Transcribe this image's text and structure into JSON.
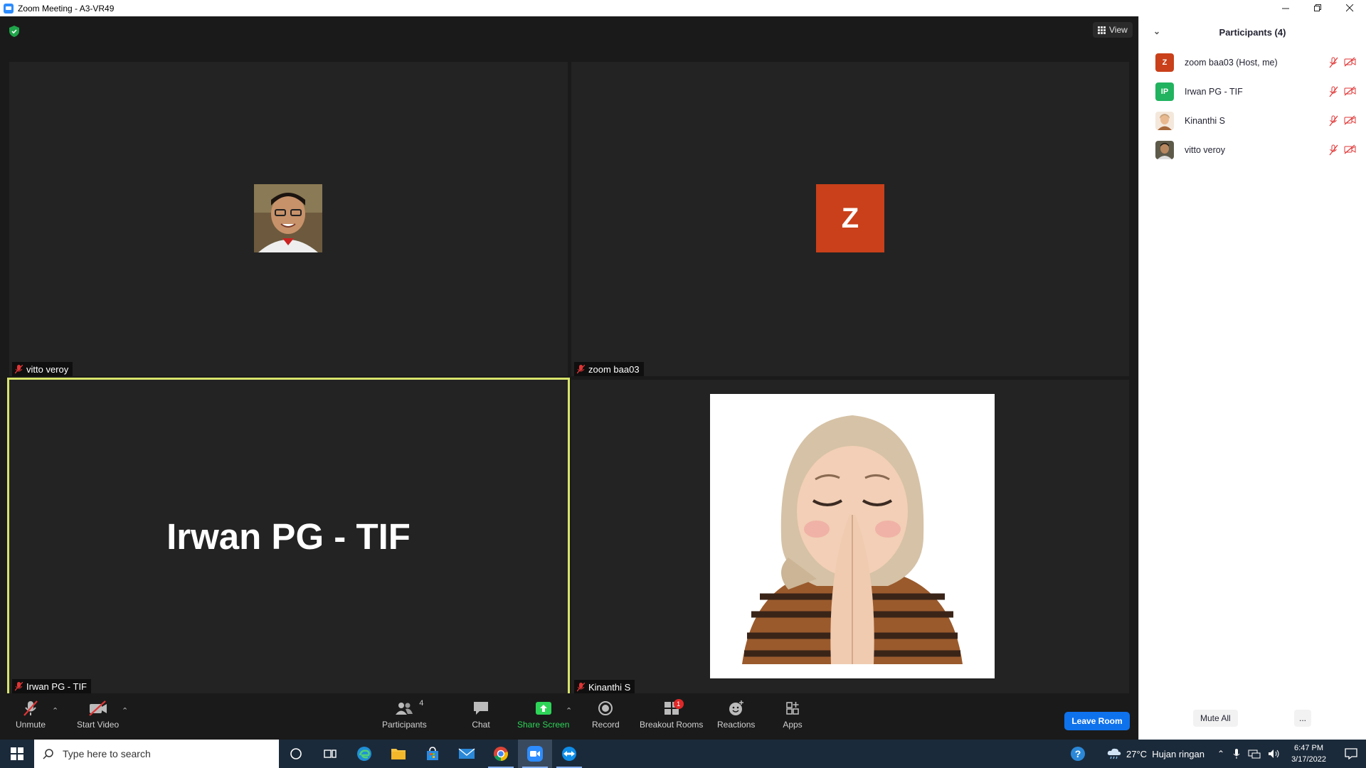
{
  "window": {
    "title": "Zoom Meeting - A3-VR49",
    "controls": [
      "minimize",
      "restore",
      "close"
    ]
  },
  "meeting": {
    "view_label": "View",
    "tiles": [
      {
        "name": "vitto veroy",
        "kind": "photo",
        "muted": true
      },
      {
        "name": "zoom baa03",
        "kind": "initial",
        "initial": "Z",
        "avatar_color": "#c9401a",
        "muted": true
      },
      {
        "name": "Irwan PG - TIF",
        "kind": "name-only",
        "display_name": "Irwan PG - TIF",
        "muted": true,
        "active_speaker": true
      },
      {
        "name": "Kinanthi S",
        "kind": "memoji",
        "muted": true
      }
    ]
  },
  "toolbar": {
    "unmute": "Unmute",
    "start_video": "Start Video",
    "participants": "Participants",
    "participants_count": "4",
    "chat": "Chat",
    "share_screen": "Share Screen",
    "record": "Record",
    "breakout_rooms": "Breakout Rooms",
    "breakout_badge": "1",
    "reactions": "Reactions",
    "apps": "Apps",
    "leave": "Leave Room",
    "share_color": "#2ed458",
    "leave_color": "#0e72ed"
  },
  "participants_panel": {
    "title": "Participants (4)",
    "items": [
      {
        "name": "zoom baa03 (Host, me)",
        "avatar": "Z",
        "avatar_color": "#c9401a",
        "mic": "muted",
        "video": "off"
      },
      {
        "name": "Irwan PG - TIF",
        "avatar": "IP",
        "avatar_color": "#21b35f",
        "mic": "muted",
        "video": "off"
      },
      {
        "name": "Kinanthi S",
        "avatar": "photo",
        "mic": "muted",
        "video": "off"
      },
      {
        "name": "vitto veroy",
        "avatar": "photo",
        "mic": "muted",
        "video": "off"
      }
    ],
    "mute_all": "Mute All",
    "more": "..."
  },
  "taskbar": {
    "search_placeholder": "Type here to search",
    "apps": [
      "cortana-icon",
      "task-view-icon",
      "edge-icon",
      "file-explorer-icon",
      "store-icon",
      "mail-icon",
      "chrome-icon",
      "zoom-icon",
      "teamviewer-icon"
    ],
    "weather": "27°C  Hujan ringan",
    "time": "6:47 PM",
    "date": "3/17/2022"
  }
}
